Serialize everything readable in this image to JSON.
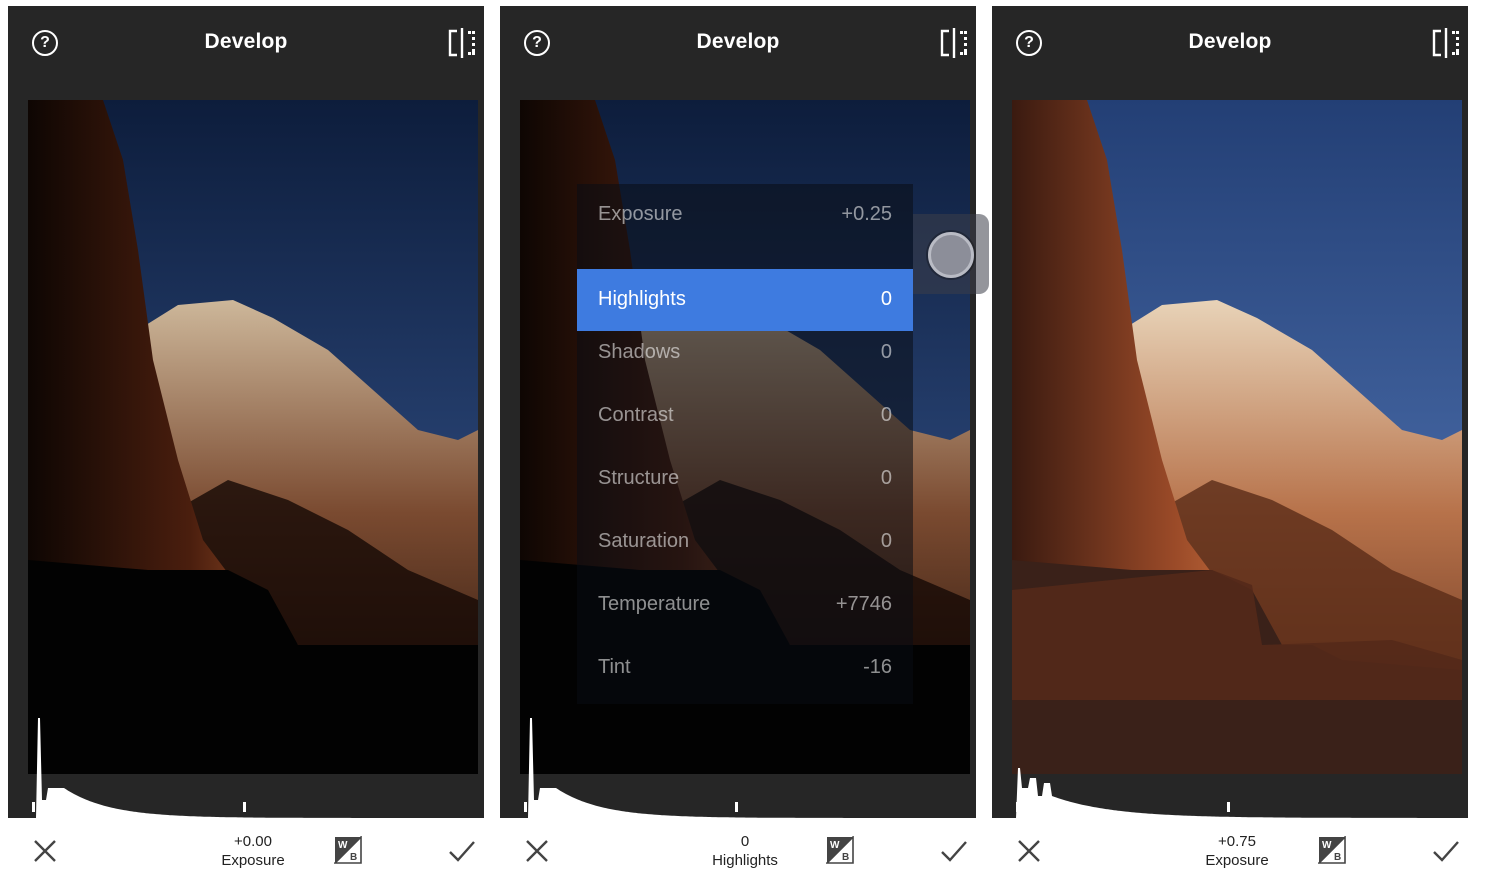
{
  "panels": [
    {
      "title": "Develop",
      "bottom_value": "+0.00",
      "bottom_label": "Exposure",
      "brightness": 0.55
    },
    {
      "title": "Develop",
      "bottom_value": "0",
      "bottom_label": "Highlights",
      "brightness": 0.55,
      "menu": [
        {
          "label": "Exposure",
          "value": "+0.25"
        },
        {
          "label": "Highlights",
          "value": "0",
          "selected": true
        },
        {
          "label": "Shadows",
          "value": "0"
        },
        {
          "label": "Contrast",
          "value": "0"
        },
        {
          "label": "Structure",
          "value": "0"
        },
        {
          "label": "Saturation",
          "value": "0"
        },
        {
          "label": "Temperature",
          "value": "+7746"
        },
        {
          "label": "Tint",
          "value": "-16"
        }
      ]
    },
    {
      "title": "Develop",
      "bottom_value": "+0.75",
      "bottom_label": "Exposure",
      "brightness": 1.0
    }
  ],
  "icons": {
    "help": "help-circle-icon",
    "compare": "compare-icon",
    "cancel": "close-icon",
    "white_balance": "white-balance-icon",
    "apply": "checkmark-icon"
  },
  "colors": {
    "toolbar_bg": "#262626",
    "selection": "#3e7be0",
    "sky_top": "#0d1d3c",
    "sky_bottom": "#3b5d9a"
  }
}
